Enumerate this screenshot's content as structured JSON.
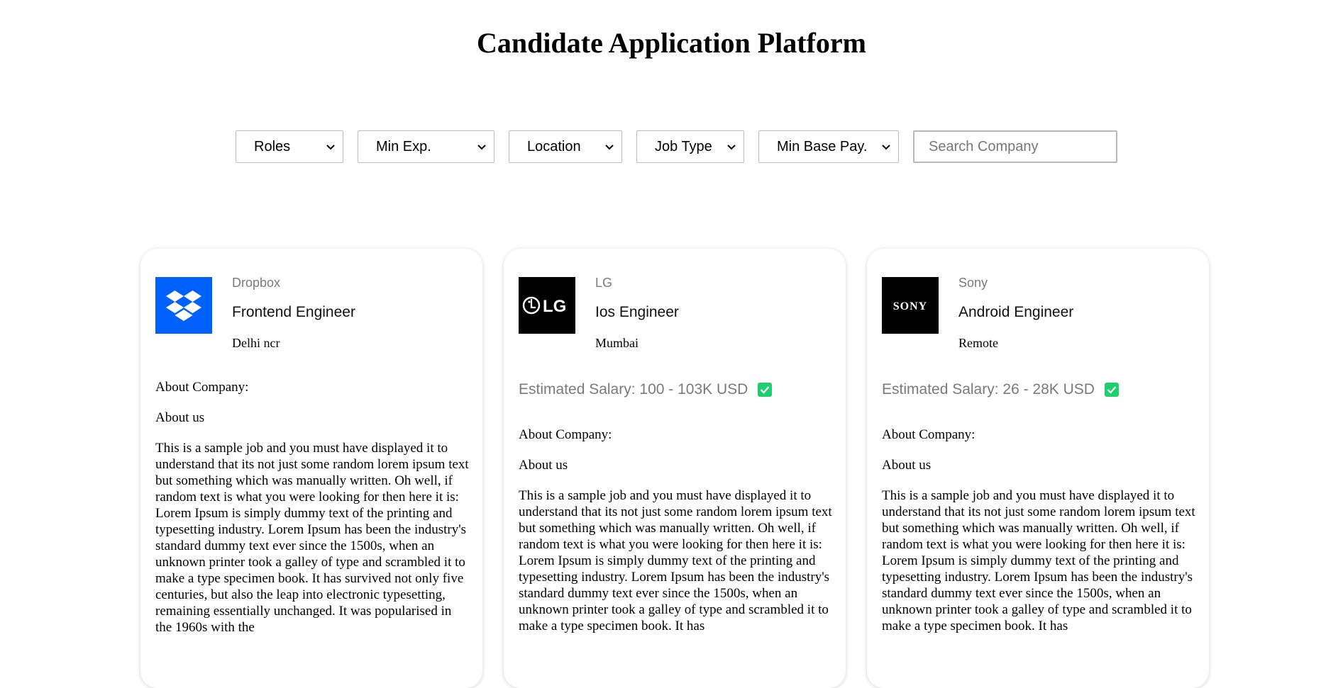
{
  "page": {
    "title": "Candidate Application Platform"
  },
  "filters": {
    "roles": "Roles",
    "min_exp": "Min Exp.",
    "location": "Location",
    "job_type": "Job Type",
    "min_base_pay": "Min Base Pay.",
    "search_placeholder": "Search Company"
  },
  "jobs": [
    {
      "company": "Dropbox",
      "role": "Frontend Engineer",
      "location": "Delhi ncr",
      "logo_icon": "dropbox-logo",
      "logo_color": "#0061fe",
      "salary": "",
      "about_heading": "About Company:",
      "about_sub": "About us",
      "about_text": "This is a sample job and you must have displayed it to understand that its not just some random lorem ipsum text but something which was manually written. Oh well, if random text is what you were looking for then here it is: Lorem Ipsum is simply dummy text of the printing and typesetting industry. Lorem Ipsum has been the industry's standard dummy text ever since the 1500s, when an unknown printer took a galley of type and scrambled it to make a type specimen book. It has survived not only five centuries, but also the leap into electronic typesetting, remaining essentially unchanged. It was popularised in the 1960s with the"
    },
    {
      "company": "LG",
      "role": "Ios Engineer",
      "location": "Mumbai",
      "logo_icon": "lg-logo",
      "logo_color": "#000000",
      "logo_text": "LG",
      "salary": "Estimated Salary: 100 - 103K USD",
      "about_heading": "About Company:",
      "about_sub": "About us",
      "about_text": "This is a sample job and you must have displayed it to understand that its not just some random lorem ipsum text but something which was manually written. Oh well, if random text is what you were looking for then here it is: Lorem Ipsum is simply dummy text of the printing and typesetting industry. Lorem Ipsum has been the industry's standard dummy text ever since the 1500s, when an unknown printer took a galley of type and scrambled it to make a type specimen book. It has"
    },
    {
      "company": "Sony",
      "role": "Android Engineer",
      "location": "Remote",
      "logo_icon": "sony-logo",
      "logo_color": "#000000",
      "logo_text": "SONY",
      "salary": "Estimated Salary: 26 - 28K USD",
      "about_heading": "About Company:",
      "about_sub": "About us",
      "about_text": "This is a sample job and you must have displayed it to understand that its not just some random lorem ipsum text but something which was manually written. Oh well, if random text is what you were looking for then here it is: Lorem Ipsum is simply dummy text of the printing and typesetting industry. Lorem Ipsum has been the industry's standard dummy text ever since the 1500s, when an unknown printer took a galley of type and scrambled it to make a type specimen book. It has"
    }
  ],
  "colors": {
    "check_green": "#1fce6e",
    "muted_text": "#7a7a7a"
  }
}
